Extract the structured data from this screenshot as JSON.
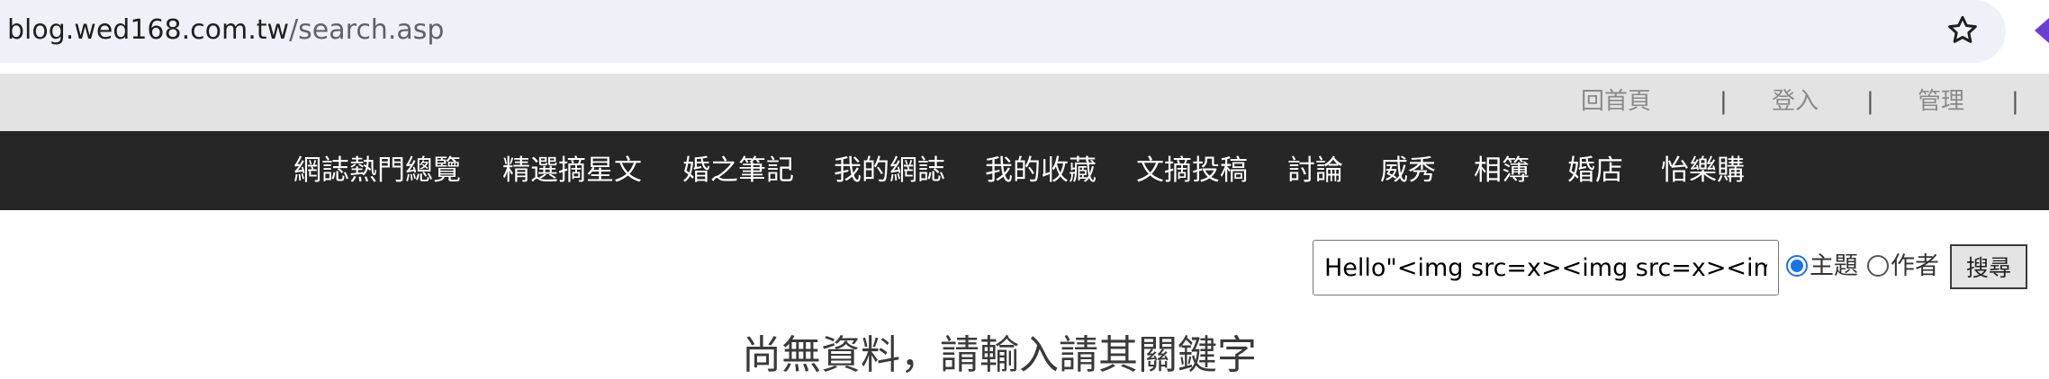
{
  "browser": {
    "url_host": "blog.wed168.com.tw",
    "url_path": "/search.asp"
  },
  "topbar": {
    "links": [
      "回首頁",
      "登入",
      "管理"
    ],
    "separator": "|"
  },
  "nav": {
    "items": [
      "網誌熱門總覽",
      "精選摘星文",
      "婚之筆記",
      "我的網誌",
      "我的收藏",
      "文摘投稿",
      "討論",
      "威秀",
      "相簿",
      "婚店",
      "怡樂購"
    ]
  },
  "search": {
    "query": "Hello\"<img src=x><img src=x><img",
    "options": [
      "主題",
      "作者"
    ],
    "selected": "主題",
    "button_label": "搜尋"
  },
  "message": "尚無資料，請輸入請其關鍵字",
  "colors": {
    "nav_bg": "#262626",
    "topbar_bg": "#e3e3e3",
    "url_bar_bg": "#eef1f8",
    "radio_accent": "#1a73e8"
  }
}
